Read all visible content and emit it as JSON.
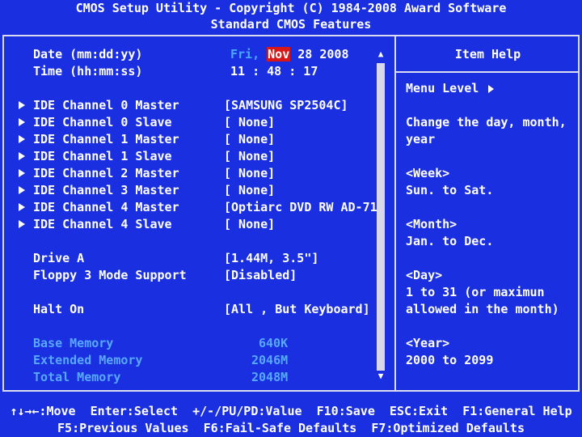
{
  "header": {
    "line1": "CMOS Setup Utility - Copyright (C) 1984-2008 Award Software",
    "line2": "Standard CMOS Features"
  },
  "date": {
    "label": "Date (mm:dd:yy)",
    "day": "Fri,",
    "month": "Nov",
    "rest": " 28 2008"
  },
  "time": {
    "label": "Time (hh:mm:ss)",
    "value": "11 : 48 : 17"
  },
  "ide": [
    {
      "label": "IDE Channel 0 Master",
      "value": "[SAMSUNG SP2504C]"
    },
    {
      "label": "IDE Channel 0 Slave",
      "value": "[ None]"
    },
    {
      "label": "IDE Channel 1 Master",
      "value": "[ None]"
    },
    {
      "label": "IDE Channel 1 Slave",
      "value": "[ None]"
    },
    {
      "label": "IDE Channel 2 Master",
      "value": "[ None]"
    },
    {
      "label": "IDE Channel 3 Master",
      "value": "[ None]"
    },
    {
      "label": "IDE Channel 4 Master",
      "value": "[Optiarc DVD RW AD-71"
    },
    {
      "label": "IDE Channel 4 Slave",
      "value": "[ None]"
    }
  ],
  "drive_a": {
    "label": "Drive A",
    "value": "[1.44M, 3.5\"]"
  },
  "floppy": {
    "label": "Floppy 3 Mode Support",
    "value": "[Disabled]"
  },
  "halt": {
    "label": "Halt On",
    "value": "[All , But Keyboard]"
  },
  "memory": [
    {
      "label": "Base Memory",
      "value": "640K"
    },
    {
      "label": "Extended Memory",
      "value": "2046M"
    },
    {
      "label": "Total Memory",
      "value": "2048M"
    }
  ],
  "help": {
    "title": "Item Help",
    "menu_level": "Menu Level",
    "desc1": "Change the day, month,",
    "desc2": "year",
    "week_h": "<Week>",
    "week_v": "Sun. to Sat.",
    "month_h": "<Month>",
    "month_v": "Jan. to Dec.",
    "day_h": "<Day>",
    "day_v1": "1 to 31 (or maximun",
    "day_v2": "allowed in the month)",
    "year_h": "<Year>",
    "year_v": "2000 to 2099"
  },
  "footer": {
    "line1": "↑↓→←:Move  Enter:Select  +/-/PU/PD:Value  F10:Save  ESC:Exit  F1:General Help",
    "line2": "F5:Previous Values  F6:Fail-Safe Defaults  F7:Optimized Defaults"
  },
  "colors": {
    "background": "#1a2fe0",
    "highlight": "#d81818",
    "dim_text": "#58a8ff",
    "border": "#dcdcf0"
  }
}
